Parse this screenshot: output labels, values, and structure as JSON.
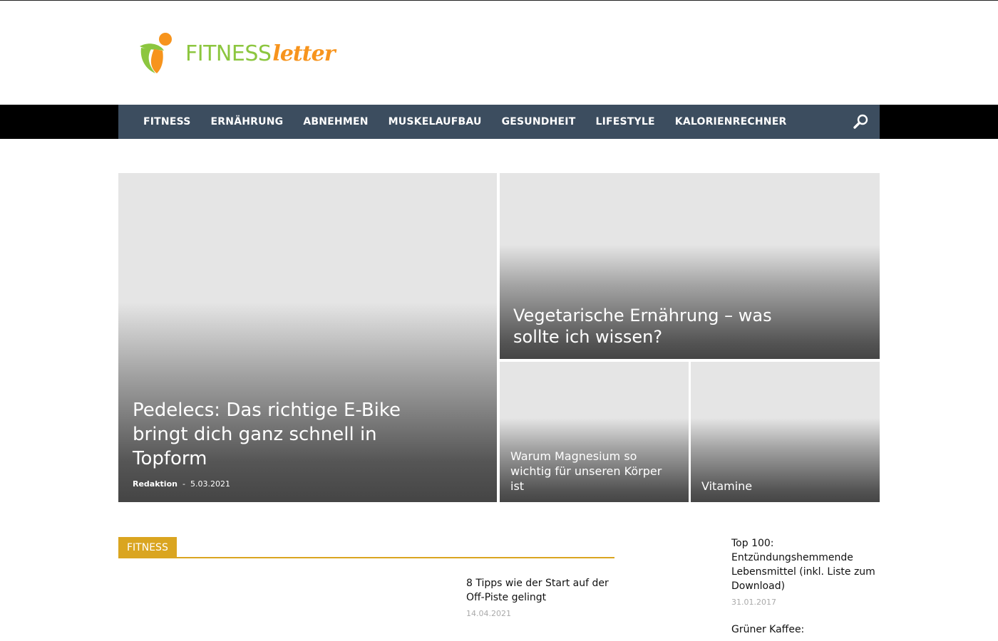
{
  "brand": {
    "fitness": "FITNESS",
    "letter": "letter",
    "colors": {
      "green": "#8cc63f",
      "orange": "#f7941d"
    }
  },
  "nav": {
    "items": [
      "FITNESS",
      "ERNÄHRUNG",
      "ABNEHMEN",
      "MUSKELAUFBAU",
      "GESUNDHEIT",
      "LIFESTYLE",
      "KALORIENRECHNER"
    ],
    "search_icon": "search-icon",
    "bg_color": "#3c4d5f"
  },
  "featured": {
    "main": {
      "title": "Pedelecs: Das richtige E-Bike bringt dich ganz schnell in Topform",
      "author": "Redaktion",
      "separator": "-",
      "date": "5.03.2021"
    },
    "top_right": {
      "title": "Vegetarische Ernährung – was sollte ich wissen?"
    },
    "small_left": {
      "title": "Warum Magnesium so wichtig für unseren Körper ist"
    },
    "small_right": {
      "title": "Vitamine"
    }
  },
  "section": {
    "label": "FITNESS",
    "accent_color": "#daa520",
    "posts": [
      {
        "title": "8 Tipps wie der Start auf der Off-Piste gelingt",
        "date": "14.04.2021"
      }
    ]
  },
  "sidebar": {
    "posts": [
      {
        "title": "Top 100: Entzündungshemmende Lebensmittel (inkl. Liste zum Download)",
        "date": "31.01.2017"
      },
      {
        "title": "Grüner Kaffee:"
      }
    ]
  }
}
